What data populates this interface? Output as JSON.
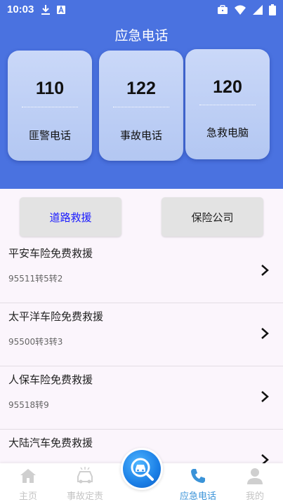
{
  "status_bar": {
    "time": "10:03",
    "left_icons": [
      "download-icon",
      "a-box-icon"
    ],
    "right_icons": [
      "briefcase-icon",
      "wifi-icon",
      "signal-icon",
      "battery-icon"
    ]
  },
  "header": {
    "title": "应急电话",
    "background_color": "#4A72E0"
  },
  "cards": [
    {
      "number": "110",
      "label": "匪警电话"
    },
    {
      "number": "122",
      "label": "事故电话"
    },
    {
      "number": "120",
      "label": "急救电脑"
    }
  ],
  "tabs": [
    {
      "label": "道路救援",
      "active": true
    },
    {
      "label": "保险公司",
      "active": false
    }
  ],
  "list": [
    {
      "title": "平安车险免费救援",
      "subtitle": "95511转5转2"
    },
    {
      "title": "太平洋车险免费救援",
      "subtitle": "95500转3转3"
    },
    {
      "title": "人保车险免费救援",
      "subtitle": "95518转9"
    },
    {
      "title": "大陆汽车免费救援",
      "subtitle": ""
    }
  ],
  "bottom_nav": {
    "items": [
      {
        "label": "主页",
        "icon": "home-icon",
        "active": false
      },
      {
        "label": "事故定责",
        "icon": "car-crash-icon",
        "active": false
      },
      {
        "label": "应急电话",
        "icon": "phone-icon",
        "active": true
      },
      {
        "label": "我的",
        "icon": "user-icon",
        "active": false
      }
    ],
    "center_button_icon": "car-search-icon",
    "active_color": "#3a93d8"
  }
}
